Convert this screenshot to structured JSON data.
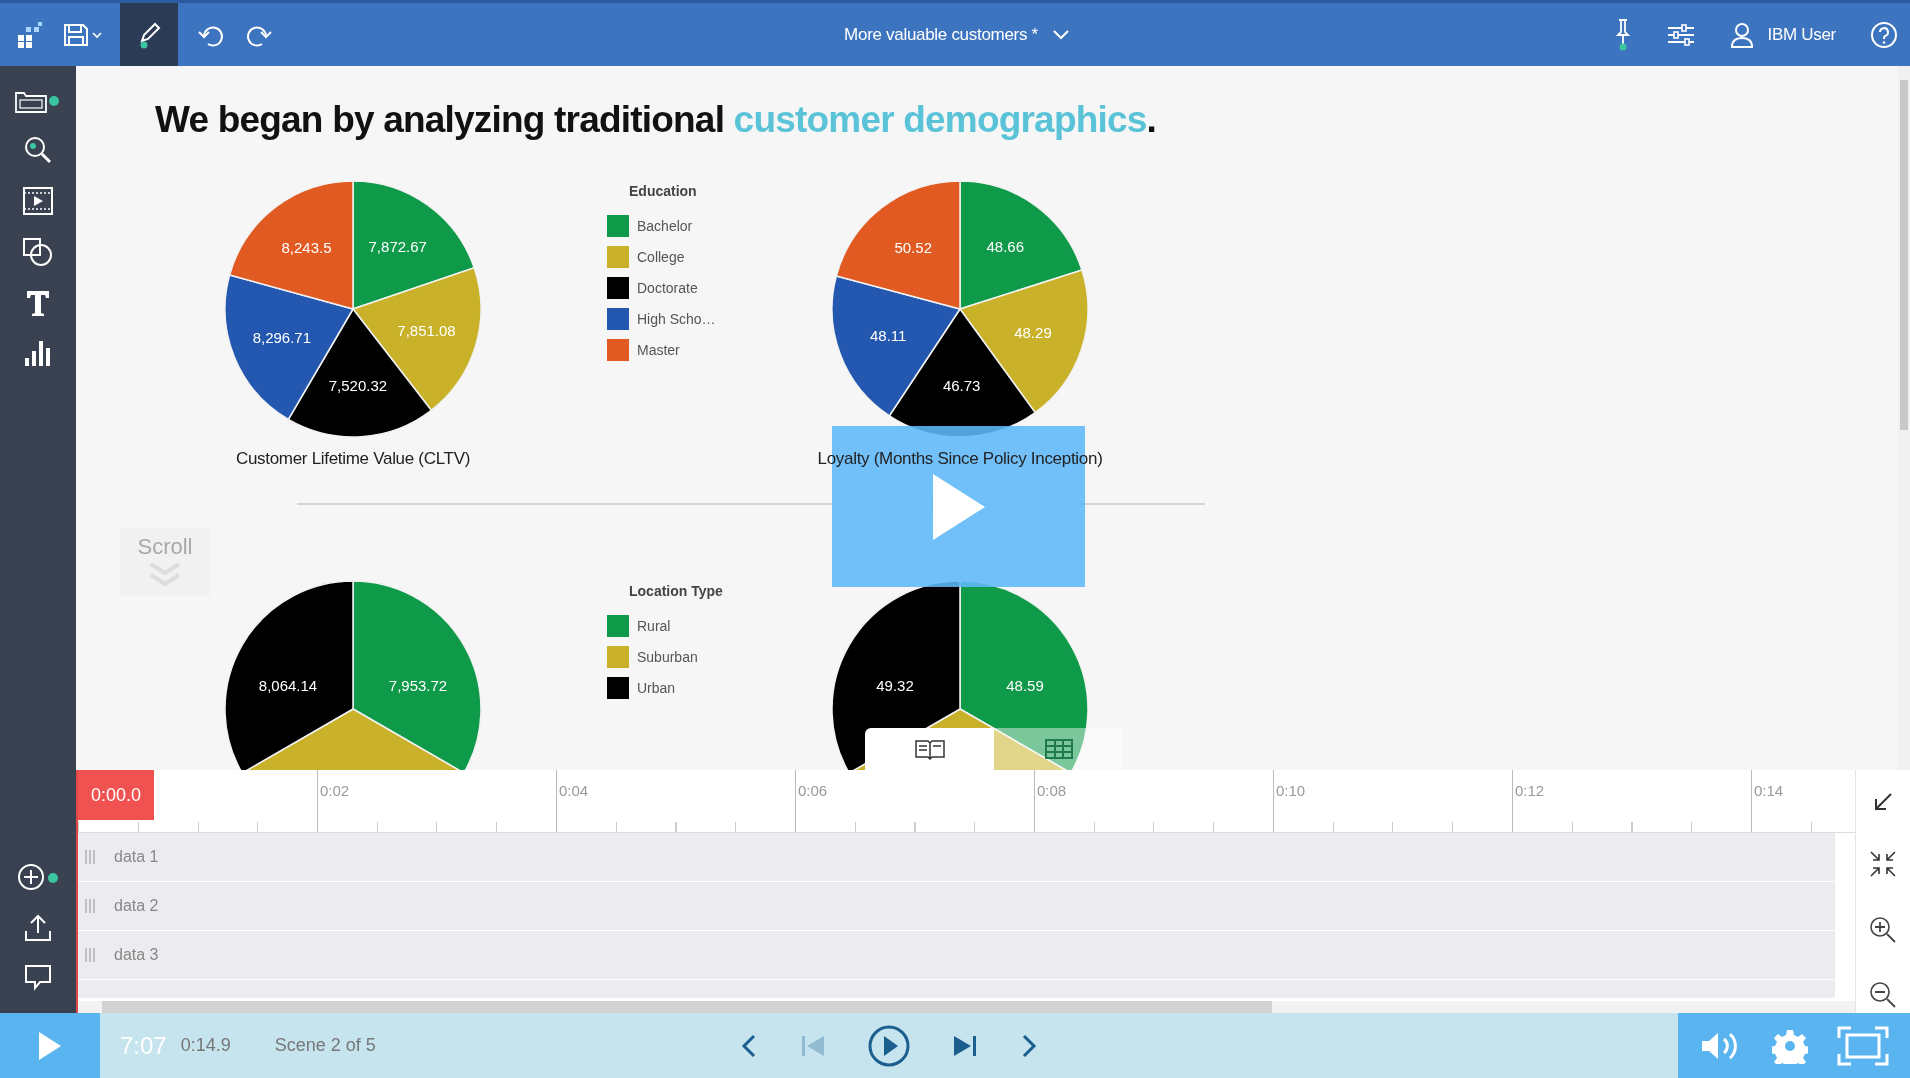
{
  "toolbar": {
    "title": "More valuable customers *",
    "user": "IBM User",
    "edit_mode": true
  },
  "heading": {
    "text": "We began by analyzing traditional ",
    "highlight": "customer demographics",
    "end": "."
  },
  "scroll_hint": "Scroll",
  "sections": [
    {
      "legend": {
        "title": "Education",
        "items": [
          {
            "label": "Bachelor",
            "color": "#0f9a4a"
          },
          {
            "label": "College",
            "color": "#c9b22a"
          },
          {
            "label": "Doctorate",
            "color": "#000000"
          },
          {
            "label": "High Scho…",
            "color": "#2458b0"
          },
          {
            "label": "Master",
            "color": "#e05a22"
          }
        ]
      },
      "charts": [
        {
          "chart_data": {
            "type": "pie",
            "title": "Customer Lifetime Value (CLTV)",
            "colors": [
              "#0f9a4a",
              "#c9b22a",
              "#000000",
              "#2458b0",
              "#e05a22"
            ],
            "values": [
              7872.67,
              7851.08,
              7520.32,
              8296.71,
              8243.5
            ],
            "value_labels": [
              "7,872.67",
              "7,851.08",
              "7,520.32",
              "8,296.71",
              "8,243.5"
            ]
          }
        },
        {
          "chart_data": {
            "type": "pie",
            "title": "Loyalty (Months Since Policy Inception)",
            "colors": [
              "#0f9a4a",
              "#c9b22a",
              "#000000",
              "#2458b0",
              "#e05a22"
            ],
            "values": [
              48.66,
              48.29,
              46.73,
              48.11,
              50.52
            ],
            "value_labels": [
              "48.66",
              "48.29",
              "46.73",
              "48.11",
              "50.52"
            ]
          }
        }
      ]
    },
    {
      "legend": {
        "title": "Location Type",
        "items": [
          {
            "label": "Rural",
            "color": "#0f9a4a"
          },
          {
            "label": "Suburban",
            "color": "#c9b22a"
          },
          {
            "label": "Urban",
            "color": "#000000"
          }
        ]
      },
      "charts": [
        {
          "kind": "pie_picture",
          "slice_labels": [
            "8,064.14",
            "7,953.72"
          ]
        },
        {
          "kind": "pie_picture",
          "slice_labels": [
            "49.32",
            "48.59"
          ]
        }
      ]
    }
  ],
  "view_switch": [
    {
      "kind": "story",
      "selected": true
    },
    {
      "kind": "grid",
      "selected": false
    }
  ],
  "timeline": {
    "playhead": "0:00.0",
    "ticks": [
      "0:02",
      "0:04",
      "0:06",
      "0:08",
      "0:10",
      "0:12",
      "0:14"
    ],
    "tracks": [
      "data 1",
      "data 2",
      "data 3"
    ]
  },
  "player": {
    "time": "7:07",
    "duration": "0:14.9",
    "scene": "Scene 2 of 5",
    "controls": [
      {
        "kind": "prev",
        "disabled": false
      },
      {
        "kind": "first",
        "disabled": true
      },
      {
        "kind": "play",
        "disabled": false
      },
      {
        "kind": "last",
        "disabled": false
      },
      {
        "kind": "next",
        "disabled": false
      }
    ]
  }
}
